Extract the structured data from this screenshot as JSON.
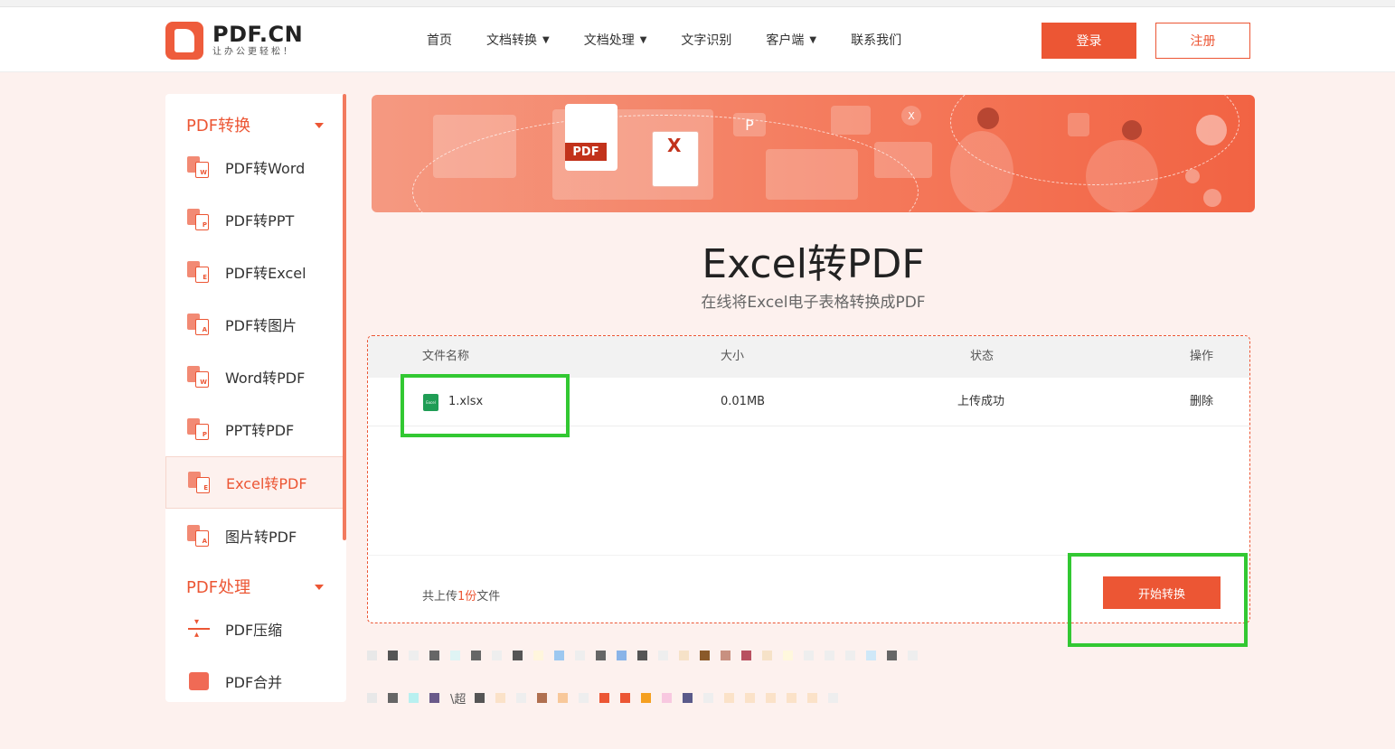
{
  "brand": {
    "name": "PDF.CN",
    "slogan": "让办公更轻松！"
  },
  "nav": {
    "items": [
      {
        "label": "首页",
        "dropdown": false
      },
      {
        "label": "文档转换",
        "dropdown": true
      },
      {
        "label": "文档处理",
        "dropdown": true
      },
      {
        "label": "文字识别",
        "dropdown": false
      },
      {
        "label": "客户端",
        "dropdown": true
      },
      {
        "label": "联系我们",
        "dropdown": false
      }
    ],
    "login": "登录",
    "register": "注册"
  },
  "sidebar": {
    "group1": "PDF转换",
    "group2": "PDF处理",
    "items": [
      {
        "label": "PDF转Word",
        "badge": "W"
      },
      {
        "label": "PDF转PPT",
        "badge": "P"
      },
      {
        "label": "PDF转Excel",
        "badge": "E"
      },
      {
        "label": "PDF转图片",
        "badge": "A"
      },
      {
        "label": "Word转PDF",
        "badge": "W"
      },
      {
        "label": "PPT转PDF",
        "badge": "P"
      },
      {
        "label": "Excel转PDF",
        "badge": "E"
      },
      {
        "label": "图片转PDF",
        "badge": "A"
      }
    ],
    "process_items": [
      {
        "label": "PDF压缩"
      },
      {
        "label": "PDF合并"
      }
    ],
    "active": "Excel转PDF"
  },
  "banner": {
    "pdf_tag": "PDF",
    "xls_mark": "X",
    "p_mark": "P",
    "x_mark": "X"
  },
  "page": {
    "title": "Excel转PDF",
    "subtitle": "在线将Excel电子表格转换成PDF"
  },
  "table": {
    "headers": {
      "name": "文件名称",
      "size": "大小",
      "status": "状态",
      "action": "操作"
    },
    "rows": [
      {
        "name": "1.xlsx",
        "size": "0.01MB",
        "status": "上传成功",
        "action": "删除",
        "icon_text": "Excel"
      }
    ]
  },
  "footer": {
    "total_prefix": "共上传",
    "total_count": "1份",
    "total_suffix": "文件",
    "start_button": "开始转换"
  },
  "blurred": {
    "text1": "\\超"
  },
  "colors": {
    "accent": "#ec5634",
    "highlight": "#32c832",
    "excel_green": "#1f9d55"
  }
}
